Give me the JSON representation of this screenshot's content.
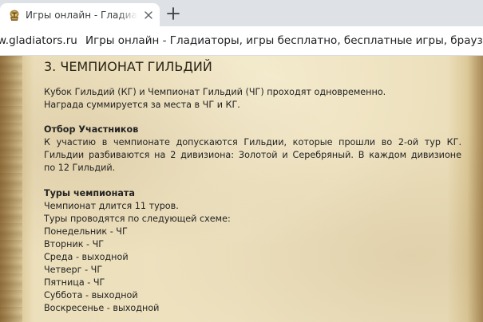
{
  "browser": {
    "tab": {
      "title": "Игры онлайн - Гладиаторы, игры бесплатно",
      "favicon": "gladiator-helmet-icon",
      "close": "close-icon"
    },
    "new_tab": "plus-icon",
    "omnibox": {
      "domain": "w.gladiators.ru",
      "page_title": "Игры онлайн - Гладиаторы, игры бесплатно, бесплатные игры, браузерные игры"
    }
  },
  "article": {
    "heading": "3. ЧЕМПИОНАТ ГИЛЬДИЙ",
    "intro": {
      "line1": "Кубок Гильдий (КГ) и Чемпионат Гильдий (ЧГ) проходят одновременно.",
      "line2": "Награда суммируется за места в ЧГ и КГ."
    },
    "selection": {
      "title": "Отбор Участников",
      "line1": "К участию в чемпионате допускаются Гильдии, которые прошли во 2-ой тур КГ.",
      "line2": "Гильдии разбиваются на 2 дивизиона: Золотой и Серебряный. В каждом дивизионе",
      "line3": "по 12 Гильдий."
    },
    "rounds": {
      "title": "Туры чемпионата",
      "line1": "Чемпионат длится 11 туров.",
      "line2": "Туры проводятся по следующей схеме:",
      "schedule": [
        "Понедельник - ЧГ",
        "Вторник - ЧГ",
        "Среда - выходной",
        "Четверг - ЧГ",
        "Пятница - ЧГ",
        "Суббота - выходной",
        "Воскресенье - выходной"
      ]
    }
  },
  "colors": {
    "tabbar": "#dee1e6",
    "parchment": "#eee2c0",
    "text": "#222222"
  }
}
